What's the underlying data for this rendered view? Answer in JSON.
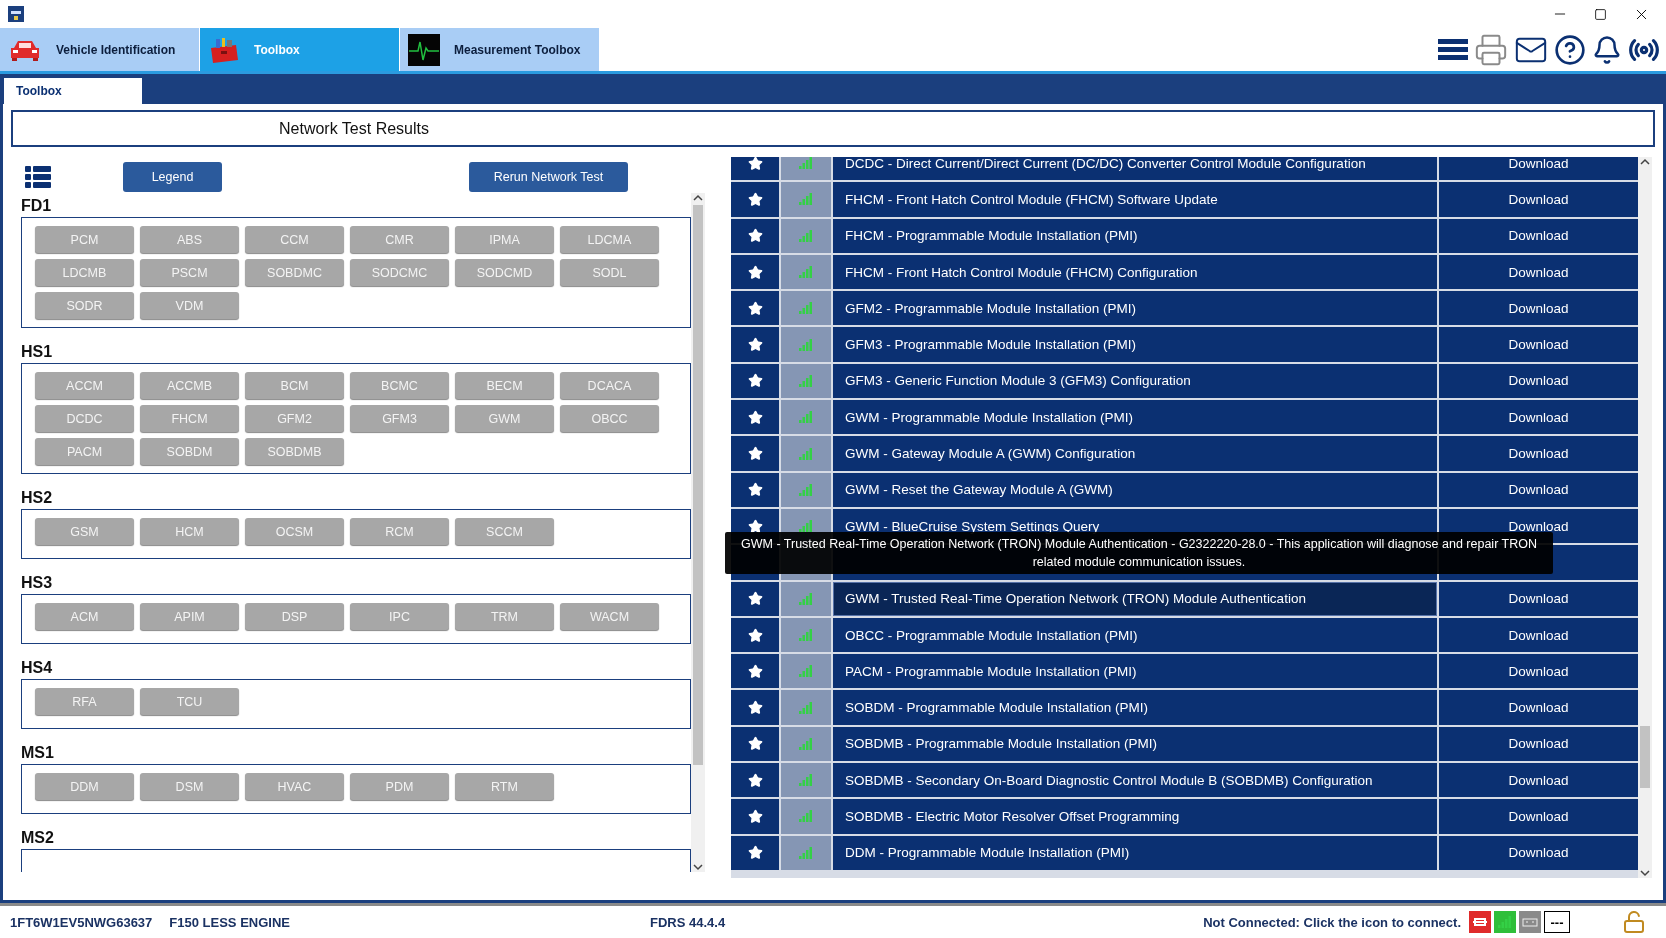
{
  "app_tabs": [
    {
      "label": "Vehicle Identification",
      "kind": "car",
      "selected": false
    },
    {
      "label": "Toolbox",
      "kind": "toolbox",
      "selected": true
    },
    {
      "label": "Measurement Toolbox",
      "kind": "monitor",
      "selected": false
    }
  ],
  "sub_tabs": [
    {
      "label": "Toolbox",
      "selected": true
    }
  ],
  "page_title": "Network Test Results",
  "legend_button": "Legend",
  "rerun_button": "Rerun Network Test",
  "networks": [
    {
      "name": "FD1",
      "modules": [
        "PCM",
        "ABS",
        "CCM",
        "CMR",
        "IPMA",
        "LDCMA",
        "LDCMB",
        "PSCM",
        "SOBDMC",
        "SODCMC",
        "SODCMD",
        "SODL",
        "SODR",
        "VDM"
      ]
    },
    {
      "name": "HS1",
      "modules": [
        "ACCM",
        "ACCMB",
        "BCM",
        "BCMC",
        "BECM",
        "DCACA",
        "DCDC",
        "FHCM",
        "GFM2",
        "GFM3",
        "GWM",
        "OBCC",
        "PACM",
        "SOBDM",
        "SOBDMB"
      ]
    },
    {
      "name": "HS2",
      "modules": [
        "GSM",
        "HCM",
        "OCSM",
        "RCM",
        "SCCM"
      ]
    },
    {
      "name": "HS3",
      "modules": [
        "ACM",
        "APIM",
        "DSP",
        "IPC",
        "TRM",
        "WACM"
      ]
    },
    {
      "name": "HS4",
      "modules": [
        "RFA",
        "TCU"
      ]
    },
    {
      "name": "MS1",
      "modules": [
        "DDM",
        "DSM",
        "HVAC",
        "PDM",
        "RTM"
      ]
    },
    {
      "name": "MS2"
    }
  ],
  "applications": [
    {
      "kind": "row",
      "name": "DCDC - Direct Current/Direct Current (DC/DC) Converter Control Module Configuration",
      "action": "Download",
      "highlighted": false
    },
    {
      "kind": "row",
      "name": "FHCM - Front Hatch Control Module (FHCM) Software Update",
      "action": "Download",
      "highlighted": false
    },
    {
      "kind": "row",
      "name": "FHCM - Programmable Module Installation (PMI)",
      "action": "Download",
      "highlighted": false
    },
    {
      "kind": "row",
      "name": "FHCM - Front Hatch Control Module (FHCM) Configuration",
      "action": "Download",
      "highlighted": false
    },
    {
      "kind": "row",
      "name": "GFM2 - Programmable Module Installation (PMI)",
      "action": "Download",
      "highlighted": false
    },
    {
      "kind": "row",
      "name": "GFM3 - Programmable Module Installation (PMI)",
      "action": "Download",
      "highlighted": false
    },
    {
      "kind": "row",
      "name": "GFM3 - Generic Function Module 3 (GFM3) Configuration",
      "action": "Download",
      "highlighted": false
    },
    {
      "kind": "row",
      "name": "GWM - Programmable Module Installation (PMI)",
      "action": "Download",
      "highlighted": false
    },
    {
      "kind": "row",
      "name": "GWM - Gateway Module A (GWM) Configuration",
      "action": "Download",
      "highlighted": false
    },
    {
      "kind": "row",
      "name": "GWM - Reset the Gateway Module A (GWM)",
      "action": "Download",
      "highlighted": false
    },
    {
      "kind": "row",
      "name": "GWM - BlueCruise System Settings Query",
      "action": "Download",
      "highlighted": false
    },
    {
      "kind": "covered"
    },
    {
      "kind": "row",
      "name": "GWM - Trusted Real-Time Operation Network (TRON) Module Authentication",
      "action": "Download",
      "highlighted": true
    },
    {
      "kind": "row",
      "name": "OBCC - Programmable Module Installation (PMI)",
      "action": "Download",
      "highlighted": false
    },
    {
      "kind": "row",
      "name": "PACM - Programmable Module Installation (PMI)",
      "action": "Download",
      "highlighted": false
    },
    {
      "kind": "row",
      "name": "SOBDM - Programmable Module Installation (PMI)",
      "action": "Download",
      "highlighted": false
    },
    {
      "kind": "row",
      "name": "SOBDMB - Programmable Module Installation (PMI)",
      "action": "Download",
      "highlighted": false
    },
    {
      "kind": "row",
      "name": "SOBDMB - Secondary On-Board Diagnostic Control Module B (SOBDMB) Configuration",
      "action": "Download",
      "highlighted": false
    },
    {
      "kind": "row",
      "name": "SOBDMB - Electric Motor Resolver Offset Programming",
      "action": "Download",
      "highlighted": false
    },
    {
      "kind": "row",
      "name": "DDM - Programmable Module Installation (PMI)",
      "action": "Download",
      "highlighted": false
    }
  ],
  "tooltip": "GWM - Trusted Real-Time Operation Network (TRON) Module Authentication - G2322220-28.0 - This application will diagnose and repair TRON related module communication issues.",
  "status_bar": {
    "vin": "1FT6W1EV5NWG63637",
    "vehicle": "F150 LESS ENGINE",
    "version": "FDRS 44.4.4",
    "connection": "Not Connected: Click the icon to connect.",
    "battery_reading": "---"
  }
}
